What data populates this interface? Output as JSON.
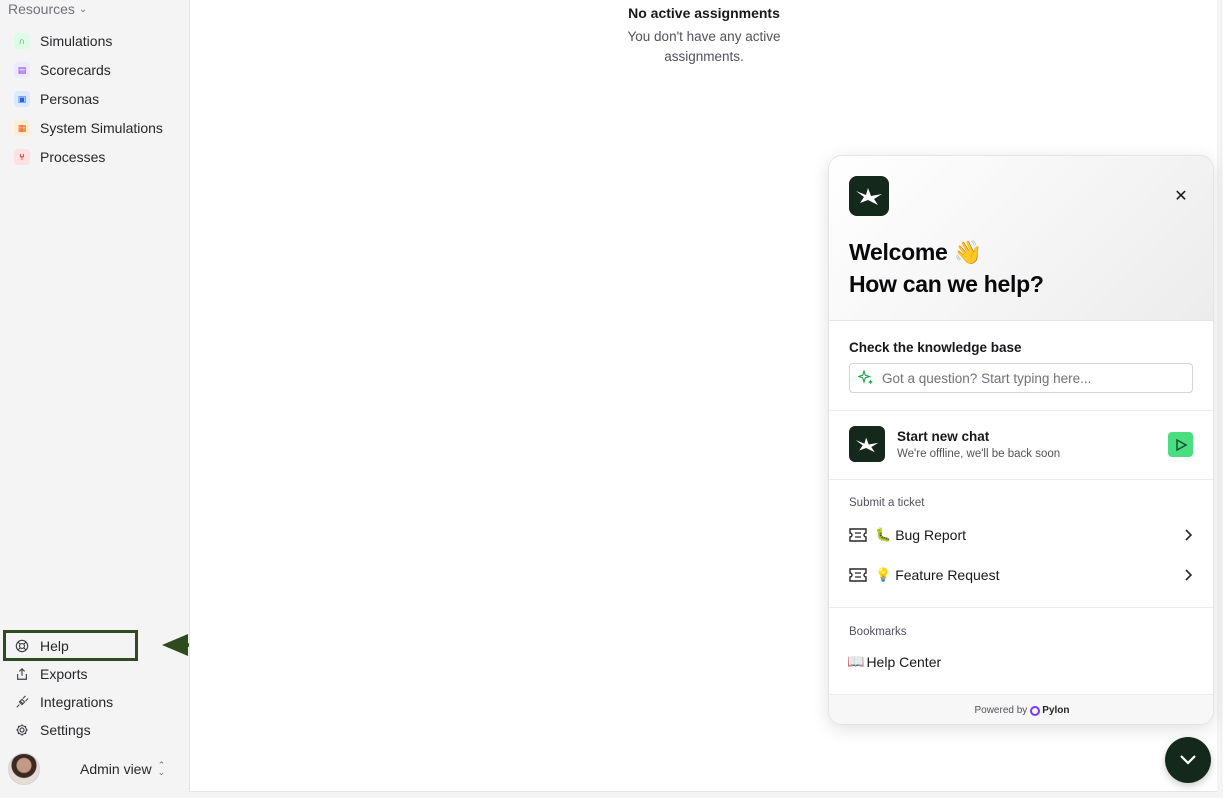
{
  "sidebar": {
    "resources_label": "Resources",
    "items": [
      {
        "label": "Simulations",
        "icon": "headset-icon",
        "color": "#16a34a"
      },
      {
        "label": "Scorecards",
        "icon": "scorecard-icon",
        "color": "#7c3aed"
      },
      {
        "label": "Personas",
        "icon": "persona-icon",
        "color": "#2563eb"
      },
      {
        "label": "System Simulations",
        "icon": "system-icon",
        "color": "#ea580c"
      },
      {
        "label": "Processes",
        "icon": "process-icon",
        "color": "#dc2626"
      }
    ],
    "bottom": {
      "help": "Help",
      "exports": "Exports",
      "integrations": "Integrations",
      "settings": "Settings"
    },
    "admin_label": "Admin view"
  },
  "main": {
    "empty_title": "No active assignments",
    "empty_desc": "You don't have any active assignments."
  },
  "widget": {
    "welcome_line1": "Welcome 👋",
    "welcome_line2": "How can we help?",
    "kb_title": "Check the knowledge base",
    "kb_placeholder": "Got a question? Start typing here...",
    "chat_title": "Start new chat",
    "chat_subtitle": "We're offline, we'll be back soon",
    "submit_label": "Submit a ticket",
    "tickets": [
      {
        "emoji": "🐛",
        "label": "Bug Report"
      },
      {
        "emoji": "💡",
        "label": "Feature Request"
      }
    ],
    "bookmarks_label": "Bookmarks",
    "bookmark_emoji": "📖",
    "bookmark_label": "Help Center",
    "powered_by": "Powered by",
    "brand": "Pylon"
  },
  "colors": {
    "brand_dark": "#15281c",
    "send_green": "#4ade80",
    "annotation": "#2f4a1f"
  }
}
